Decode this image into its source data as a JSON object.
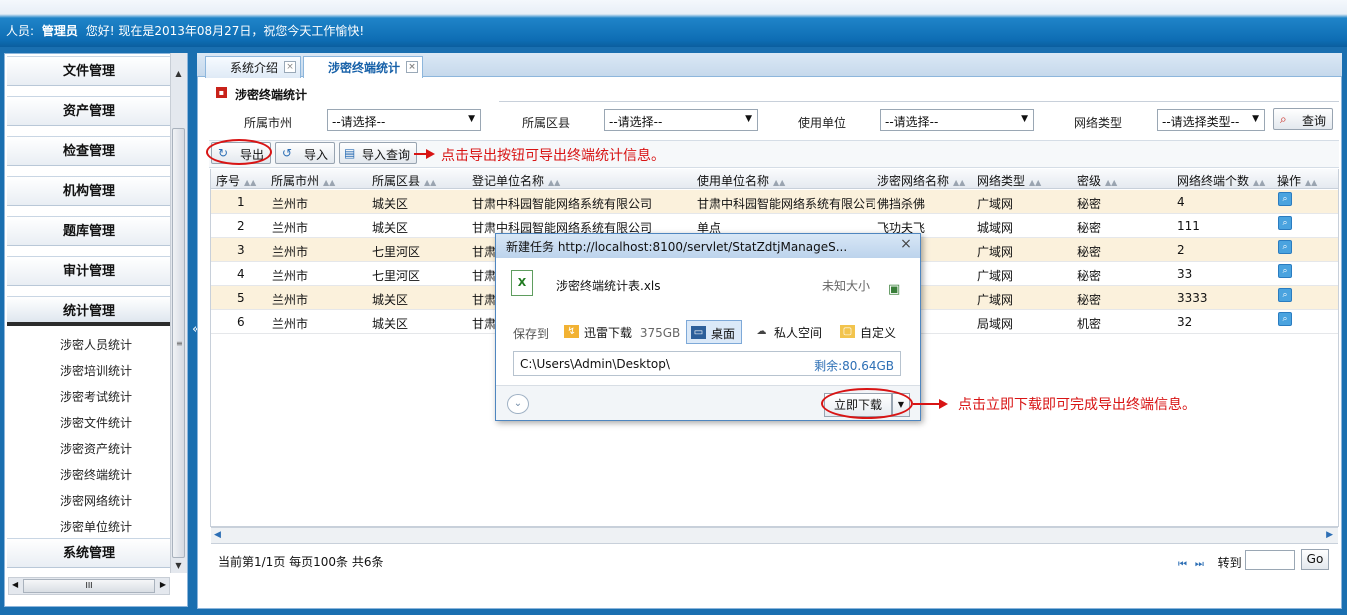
{
  "header": {
    "user_prefix": "人员:",
    "user_name": "管理员",
    "greeting": "您好!  现在是2013年08月27日，祝您今天工作愉快!"
  },
  "sidebar": {
    "menus": [
      {
        "label": "文件管理"
      },
      {
        "label": "资产管理"
      },
      {
        "label": "检查管理"
      },
      {
        "label": "机构管理"
      },
      {
        "label": "题库管理"
      },
      {
        "label": "审计管理"
      },
      {
        "label": "统计管理"
      },
      {
        "label": "系统管理"
      }
    ],
    "submenus": [
      {
        "label": "涉密人员统计"
      },
      {
        "label": "涉密培训统计"
      },
      {
        "label": "涉密考试统计"
      },
      {
        "label": "涉密文件统计"
      },
      {
        "label": "涉密资产统计"
      },
      {
        "label": "涉密终端统计"
      },
      {
        "label": "涉密网络统计"
      },
      {
        "label": "涉密单位统计"
      }
    ],
    "scroll_grip": "III"
  },
  "tabs": [
    {
      "label": "系统介绍"
    },
    {
      "label": "涉密终端统计"
    }
  ],
  "panel": {
    "title": "涉密终端统计"
  },
  "filters": [
    {
      "label": "所属市州",
      "value": "--请选择--"
    },
    {
      "label": "所属区县",
      "value": "--请选择--"
    },
    {
      "label": "使用单位",
      "value": "--请选择--"
    },
    {
      "label": "网络类型",
      "value": "--请选择类型--"
    }
  ],
  "buttons": {
    "query": "查询",
    "export": "导出",
    "import": "导入",
    "import_query": "导入查询"
  },
  "annotations": {
    "export_hint": "点击导出按钮可导出终端统计信息。",
    "download_hint": "点击立即下载即可完成导出终端信息。"
  },
  "table": {
    "columns": [
      "序号",
      "所属市州",
      "所属区县",
      "登记单位名称",
      "使用单位名称",
      "涉密网络名称",
      "网络类型",
      "密级",
      "网络终端个数",
      "操作"
    ],
    "rows": [
      [
        "1",
        "兰州市",
        "城关区",
        "甘肃中科园智能网络系统有限公司",
        "甘肃中科园智能网络系统有限公司",
        "佛挡杀佛",
        "广域网",
        "秘密",
        "4"
      ],
      [
        "2",
        "兰州市",
        "城关区",
        "甘肃中科园智能网络系统有限公司",
        "单点",
        "飞功夫飞",
        "城域网",
        "秘密",
        "111"
      ],
      [
        "3",
        "兰州市",
        "七里河区",
        "甘肃",
        "",
        "",
        "广域网",
        "秘密",
        "2"
      ],
      [
        "4",
        "兰州市",
        "七里河区",
        "甘肃",
        "",
        "",
        "广域网",
        "秘密",
        "33"
      ],
      [
        "5",
        "兰州市",
        "城关区",
        "甘肃",
        "",
        "",
        "广域网",
        "秘密",
        "3333"
      ],
      [
        "6",
        "兰州市",
        "城关区",
        "甘肃",
        "",
        "",
        "局域网",
        "机密",
        "32"
      ]
    ]
  },
  "pager": {
    "summary": "当前第1/1页  每页100条  共6条",
    "goto_label": "转到",
    "go": "Go"
  },
  "dialog": {
    "title": "新建任务  http://localhost:8100/servlet/StatZdtjManageS...",
    "filename": "涉密终端统计表.xls",
    "size": "未知大小",
    "save_to": "保存到",
    "options": [
      {
        "label": "迅雷下载",
        "extra": "375GB"
      },
      {
        "label": "桌面",
        "extra": ""
      },
      {
        "label": "私人空间",
        "extra": ""
      },
      {
        "label": "自定义",
        "extra": ""
      }
    ],
    "path": "C:\\Users\\Admin\\Desktop\\",
    "free": "剩余:80.64GB",
    "download": "立即下载"
  },
  "colors": {
    "accent": "#1f84c8",
    "annotation": "#d81414",
    "row_highlight": "#fbf1dc"
  }
}
